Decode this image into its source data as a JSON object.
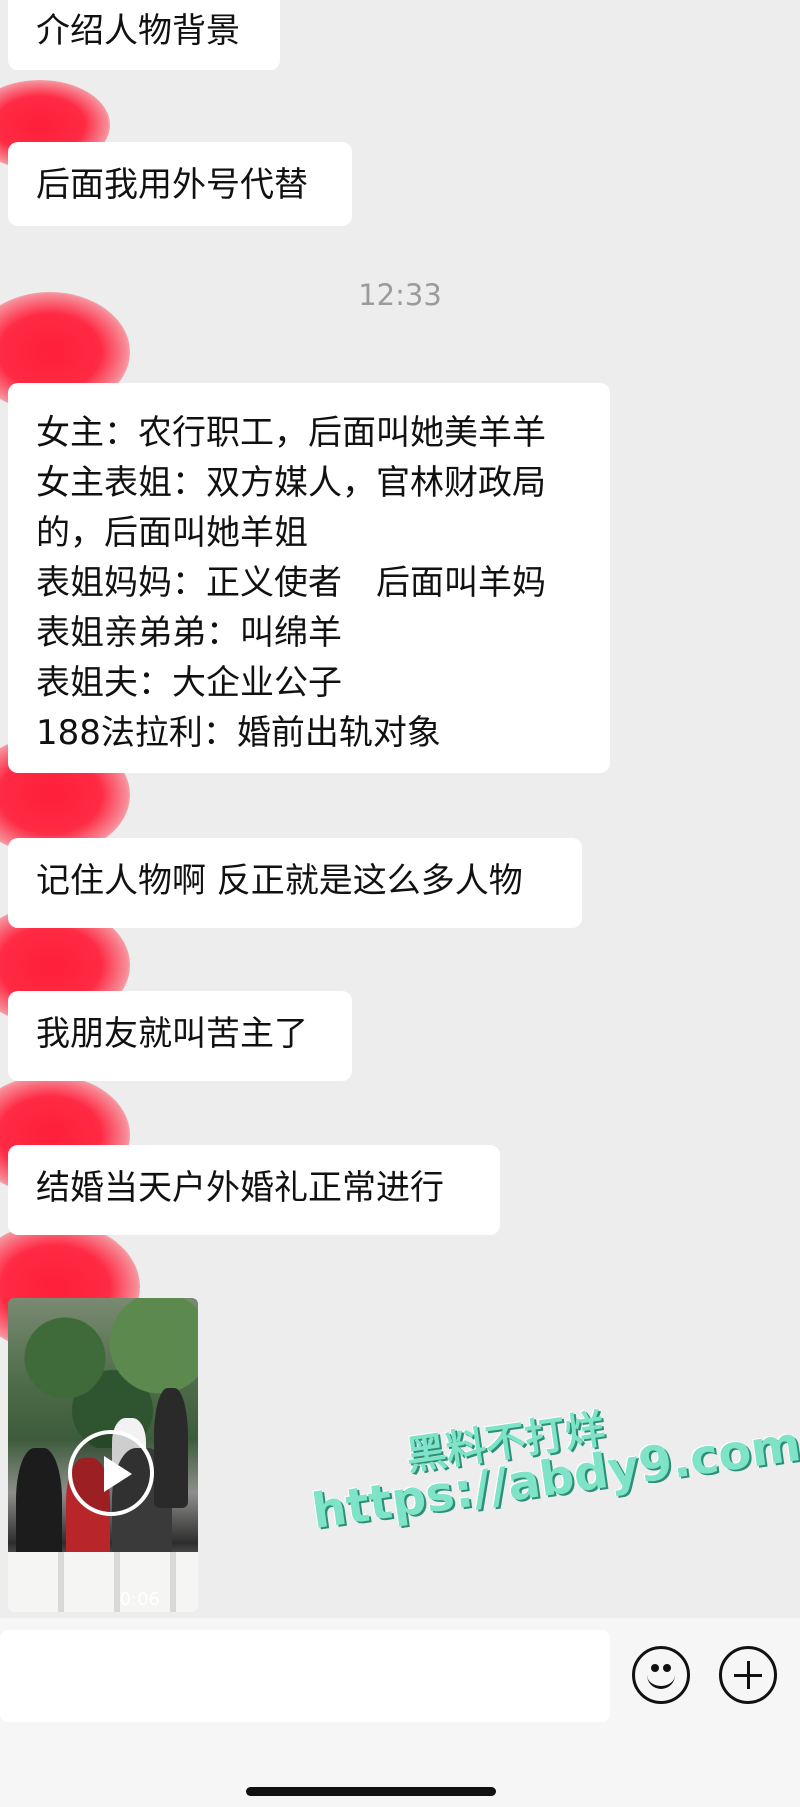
{
  "messages": [
    {
      "text": "介绍人物背景"
    },
    {
      "text": "后面我用外号代替"
    },
    {
      "lines": [
        "女主：农行职工，后面叫她美羊羊",
        "女主表姐：双方媒人，官林财政局",
        "的，后面叫她羊姐",
        "表姐妈妈：正义使者　后面叫羊妈",
        "表姐亲弟弟：叫绵羊",
        "表姐夫：大企业公子",
        "188法拉利：婚前出轨对象"
      ]
    },
    {
      "text": "记住人物啊 反正就是这么多人物"
    },
    {
      "text": "我朋友就叫苦主了"
    },
    {
      "text": "结婚当天户外婚礼正常进行"
    }
  ],
  "timestamp": "12:33",
  "video": {
    "duration": "0:06"
  },
  "watermark": {
    "line1": "黑料不打烊",
    "line2": "https://abdy9.com"
  },
  "input": {
    "value": ""
  },
  "colors": {
    "background": "#ededed",
    "bubble": "#ffffff",
    "avatar": "#ff2a44",
    "watermark": "#7fe3c7"
  }
}
